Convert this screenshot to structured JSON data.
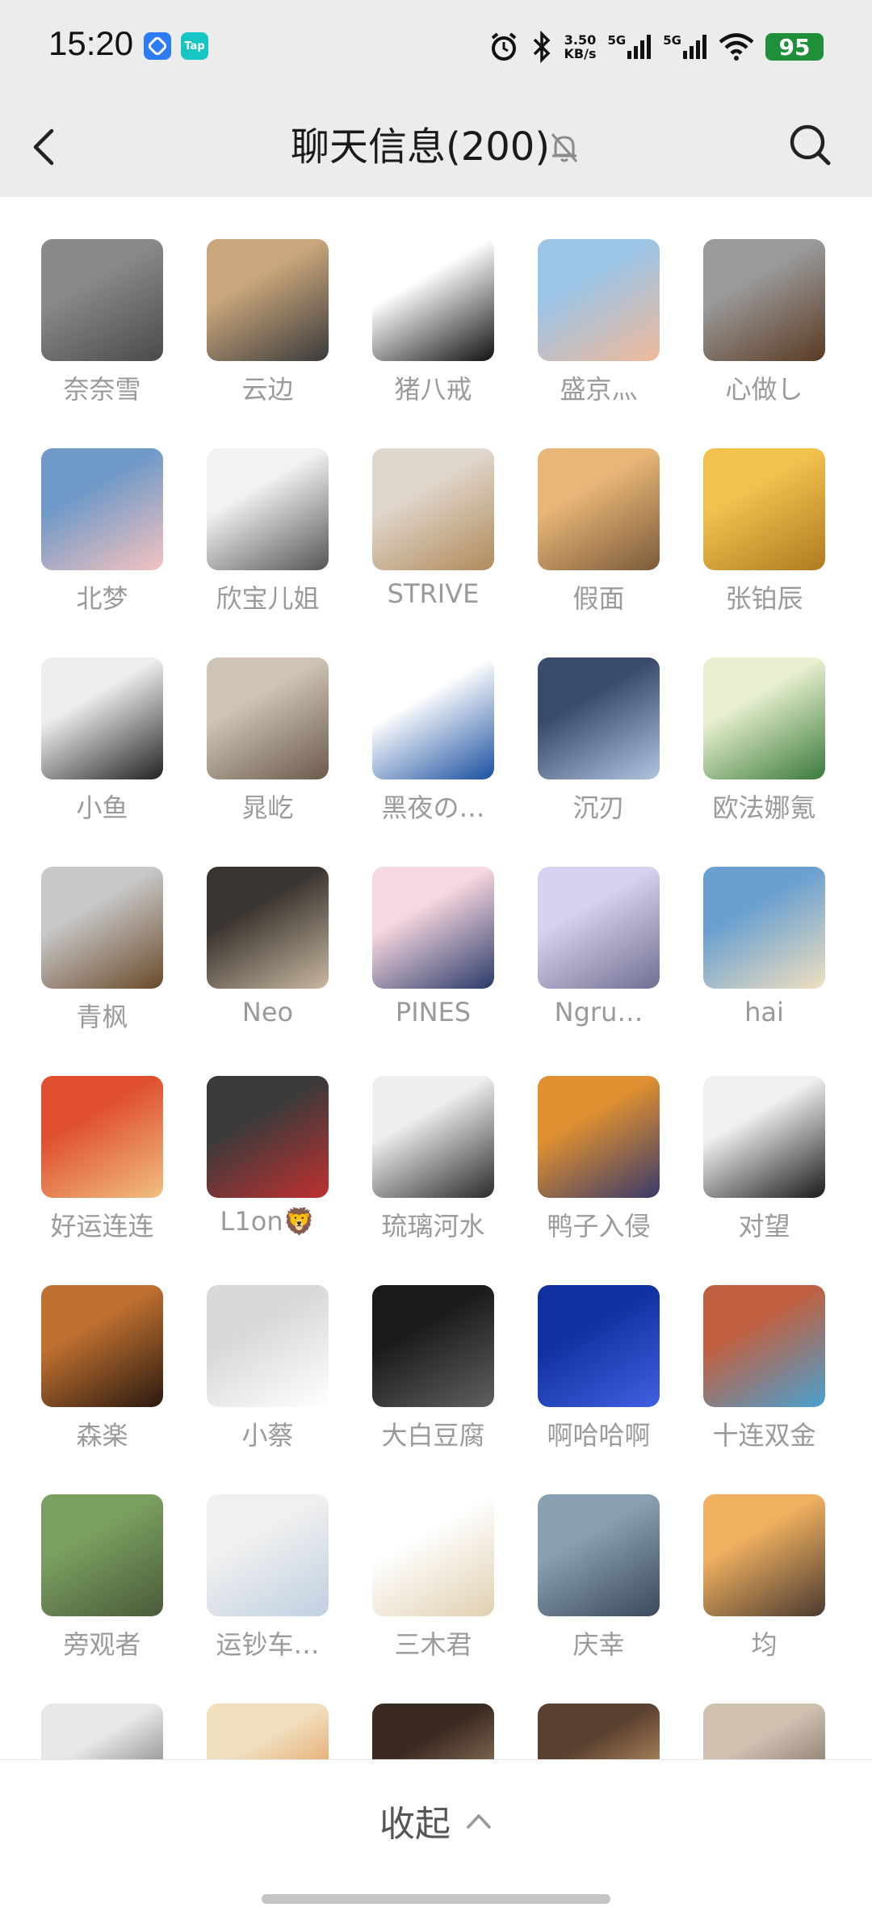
{
  "status_bar": {
    "time": "15:20",
    "net_speed_value": "3.50",
    "net_speed_unit": "KB/s",
    "signal1": "5G",
    "signal2": "5G",
    "battery": "95",
    "app_badge_2": "Tap"
  },
  "header": {
    "title": "聊天信息(200)"
  },
  "members": [
    {
      "name": "奈奈雪",
      "colors": [
        "#8a8a8a",
        "#4a4a4a"
      ]
    },
    {
      "name": "云边",
      "colors": [
        "#c9a67b",
        "#3a3a3a"
      ]
    },
    {
      "name": "猪八戒",
      "colors": [
        "#ffffff",
        "#111111"
      ]
    },
    {
      "name": "盛京灬",
      "colors": [
        "#9cc4e6",
        "#f0b99a"
      ]
    },
    {
      "name": "心做し",
      "colors": [
        "#9a9a9a",
        "#5a3a22"
      ]
    },
    {
      "name": "北梦",
      "colors": [
        "#6f99c8",
        "#f5c3c0"
      ]
    },
    {
      "name": "欣宝儿姐",
      "colors": [
        "#f2f2f2",
        "#555555"
      ]
    },
    {
      "name": "STRIVE",
      "colors": [
        "#e0d7cc",
        "#b08a5a"
      ]
    },
    {
      "name": "假面",
      "colors": [
        "#e8b677",
        "#7b5a3a"
      ]
    },
    {
      "name": "张铂辰",
      "colors": [
        "#f2c14e",
        "#b07a20"
      ]
    },
    {
      "name": "小鱼",
      "colors": [
        "#eeeeee",
        "#222222"
      ]
    },
    {
      "name": "晁屹",
      "colors": [
        "#cfc3b5",
        "#6a5a4a"
      ]
    },
    {
      "name": "黑夜の…",
      "colors": [
        "#ffffff",
        "#1a4fa0"
      ]
    },
    {
      "name": "沉刃",
      "colors": [
        "#3a4a6a",
        "#b0c4e0"
      ]
    },
    {
      "name": "欧法娜氪",
      "colors": [
        "#e8f0d0",
        "#3a7a3a"
      ]
    },
    {
      "name": "青枫",
      "colors": [
        "#c8c8c8",
        "#6a4a2a"
      ]
    },
    {
      "name": "Neo",
      "colors": [
        "#3a3530",
        "#c8b8a0"
      ]
    },
    {
      "name": "PINES",
      "colors": [
        "#f8d8e0",
        "#2a3a6a"
      ]
    },
    {
      "name": "Ngru…",
      "colors": [
        "#d8d0f0",
        "#707090"
      ]
    },
    {
      "name": "hai",
      "colors": [
        "#6aa0d0",
        "#f0e0c0"
      ]
    },
    {
      "name": "好运连连",
      "colors": [
        "#e05030",
        "#f0c080"
      ]
    },
    {
      "name": "L1on🦁",
      "colors": [
        "#3a3a3a",
        "#c03030"
      ]
    },
    {
      "name": "琉璃河水",
      "colors": [
        "#eeeeee",
        "#2a2a2a"
      ]
    },
    {
      "name": "鸭子入侵",
      "colors": [
        "#e09030",
        "#3a3a6a"
      ]
    },
    {
      "name": "对望",
      "colors": [
        "#f0f0f0",
        "#1a1a1a"
      ]
    },
    {
      "name": "森楽",
      "colors": [
        "#c07030",
        "#2a1a10"
      ]
    },
    {
      "name": "小蔡",
      "colors": [
        "#d8d8d8",
        "#ffffff"
      ]
    },
    {
      "name": "大白豆腐",
      "colors": [
        "#1a1a1a",
        "#606060"
      ]
    },
    {
      "name": "啊哈哈啊",
      "colors": [
        "#1030a0",
        "#4060e0"
      ]
    },
    {
      "name": "十连双金",
      "colors": [
        "#c06040",
        "#4aa0d0"
      ]
    },
    {
      "name": "旁观者",
      "colors": [
        "#7aa060",
        "#4a5a3a"
      ]
    },
    {
      "name": "运钞车…",
      "colors": [
        "#f0f0f0",
        "#c0d0e0"
      ]
    },
    {
      "name": "三木君",
      "colors": [
        "#ffffff",
        "#e0d0b0"
      ]
    },
    {
      "name": "庆幸",
      "colors": [
        "#8aa0b0",
        "#3a4a5a"
      ]
    },
    {
      "name": "均",
      "colors": [
        "#f0b060",
        "#4a3a30"
      ]
    },
    {
      "name": "",
      "colors": [
        "#e8e8e8",
        "#4a4a4a"
      ]
    },
    {
      "name": "",
      "colors": [
        "#f0e0c0",
        "#e08030"
      ]
    },
    {
      "name": "",
      "colors": [
        "#3a2a20",
        "#c0a080"
      ]
    },
    {
      "name": "",
      "colors": [
        "#5a4030",
        "#f0c080"
      ]
    },
    {
      "name": "",
      "colors": [
        "#d0c0b0",
        "#5a4a40"
      ]
    }
  ],
  "footer": {
    "collapse_label": "收起"
  }
}
